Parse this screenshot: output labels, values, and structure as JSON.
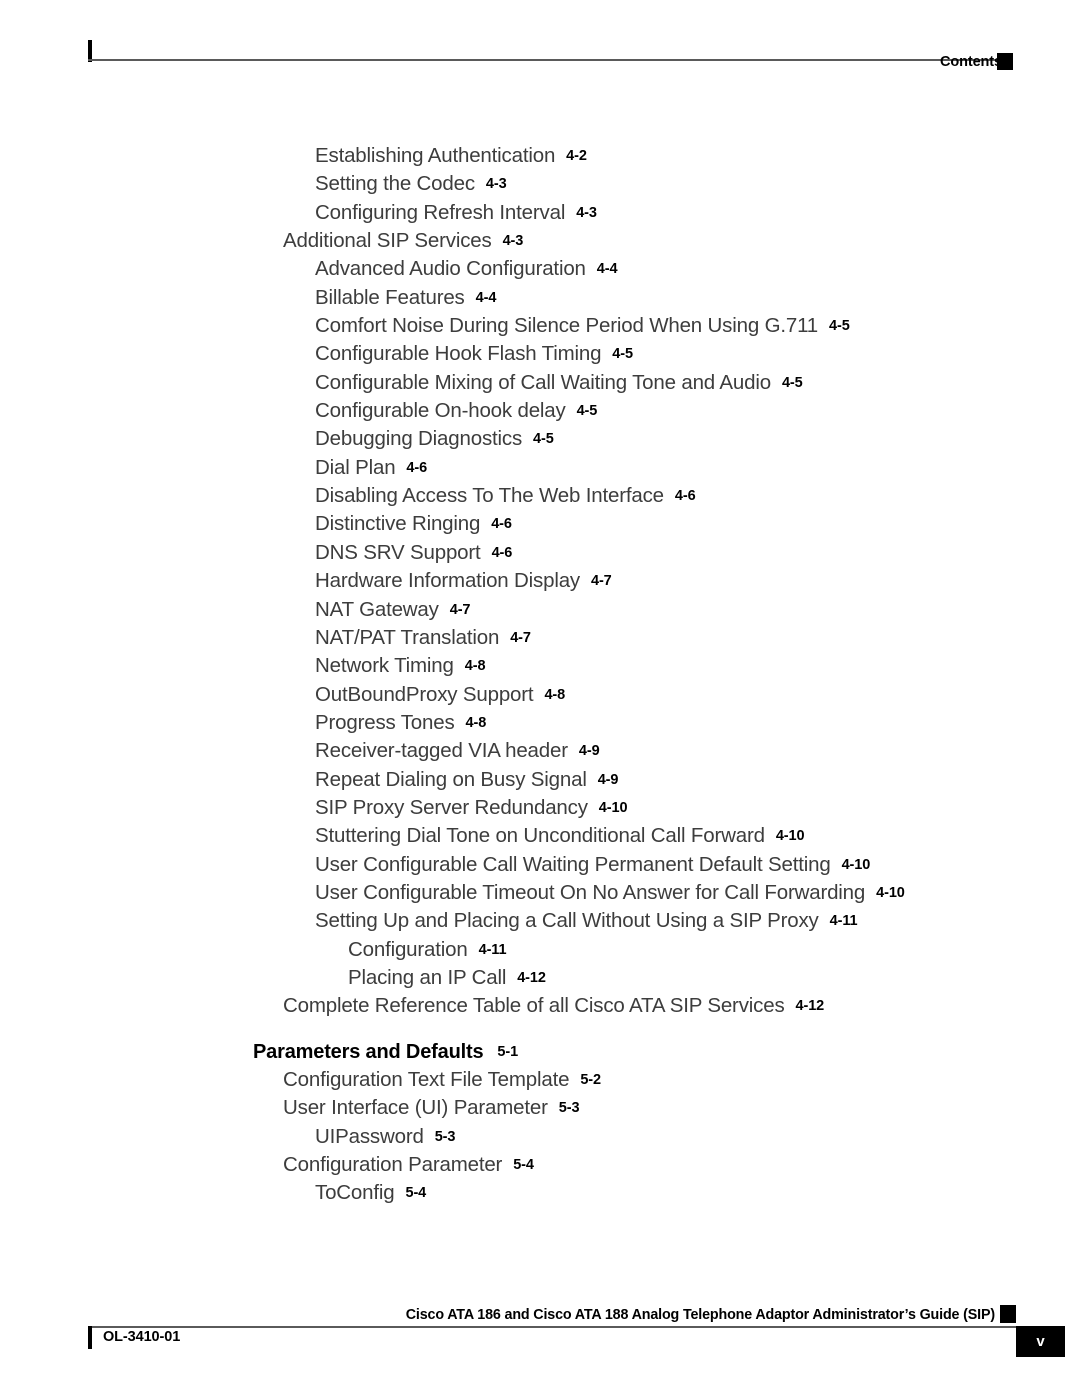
{
  "header": {
    "label": "Contents"
  },
  "toc": {
    "entries": [
      {
        "title": "Establishing Authentication",
        "page": "4-2",
        "level": 2
      },
      {
        "title": "Setting the Codec",
        "page": "4-3",
        "level": 2
      },
      {
        "title": "Configuring Refresh Interval",
        "page": "4-3",
        "level": 2
      },
      {
        "title": "Additional SIP Services",
        "page": "4-3",
        "level": 1
      },
      {
        "title": "Advanced Audio Configuration",
        "page": "4-4",
        "level": 2
      },
      {
        "title": "Billable Features",
        "page": "4-4",
        "level": 2
      },
      {
        "title": "Comfort Noise During Silence Period When Using G.711",
        "page": "4-5",
        "level": 2
      },
      {
        "title": "Configurable Hook Flash Timing",
        "page": "4-5",
        "level": 2
      },
      {
        "title": "Configurable Mixing of Call Waiting Tone and Audio",
        "page": "4-5",
        "level": 2
      },
      {
        "title": "Configurable On-hook delay",
        "page": "4-5",
        "level": 2
      },
      {
        "title": "Debugging Diagnostics",
        "page": "4-5",
        "level": 2
      },
      {
        "title": "Dial Plan",
        "page": "4-6",
        "level": 2
      },
      {
        "title": "Disabling Access To The Web Interface",
        "page": "4-6",
        "level": 2
      },
      {
        "title": "Distinctive Ringing",
        "page": "4-6",
        "level": 2
      },
      {
        "title": "DNS SRV Support",
        "page": "4-6",
        "level": 2
      },
      {
        "title": "Hardware Information Display",
        "page": "4-7",
        "level": 2
      },
      {
        "title": "NAT Gateway",
        "page": "4-7",
        "level": 2
      },
      {
        "title": "NAT/PAT Translation",
        "page": "4-7",
        "level": 2
      },
      {
        "title": "Network Timing",
        "page": "4-8",
        "level": 2
      },
      {
        "title": "OutBoundProxy Support",
        "page": "4-8",
        "level": 2
      },
      {
        "title": "Progress Tones",
        "page": "4-8",
        "level": 2
      },
      {
        "title": "Receiver-tagged VIA header",
        "page": "4-9",
        "level": 2
      },
      {
        "title": "Repeat Dialing on Busy Signal",
        "page": "4-9",
        "level": 2
      },
      {
        "title": "SIP Proxy Server Redundancy",
        "page": "4-10",
        "level": 2
      },
      {
        "title": "Stuttering Dial Tone on Unconditional Call Forward",
        "page": "4-10",
        "level": 2
      },
      {
        "title": "User Configurable Call Waiting Permanent Default Setting",
        "page": "4-10",
        "level": 2
      },
      {
        "title": "User Configurable Timeout On No Answer for Call Forwarding",
        "page": "4-10",
        "level": 2
      },
      {
        "title": "Setting Up and Placing a Call Without Using a SIP Proxy",
        "page": "4-11",
        "level": 2
      },
      {
        "title": "Configuration",
        "page": "4-11",
        "level": 3
      },
      {
        "title": "Placing an IP Call",
        "page": "4-12",
        "level": 3
      },
      {
        "title": "Complete Reference Table of all Cisco ATA SIP Services",
        "page": "4-12",
        "level": 1
      },
      {
        "title": "Parameters and Defaults",
        "page": "5-1",
        "level": 0,
        "chapter": true,
        "gap_before": true
      },
      {
        "title": "Configuration Text File Template",
        "page": "5-2",
        "level": 1
      },
      {
        "title": "User Interface (UI) Parameter",
        "page": "5-3",
        "level": 1
      },
      {
        "title": "UIPassword",
        "page": "5-3",
        "level": 2
      },
      {
        "title": "Configuration Parameter",
        "page": "5-4",
        "level": 1
      },
      {
        "title": "ToConfig",
        "page": "5-4",
        "level": 2
      }
    ]
  },
  "footer": {
    "title": "Cisco ATA 186 and Cisco ATA 188 Analog Telephone Adaptor Administrator’s Guide (SIP)",
    "doc_id": "OL-3410-01",
    "page_number": "v"
  }
}
